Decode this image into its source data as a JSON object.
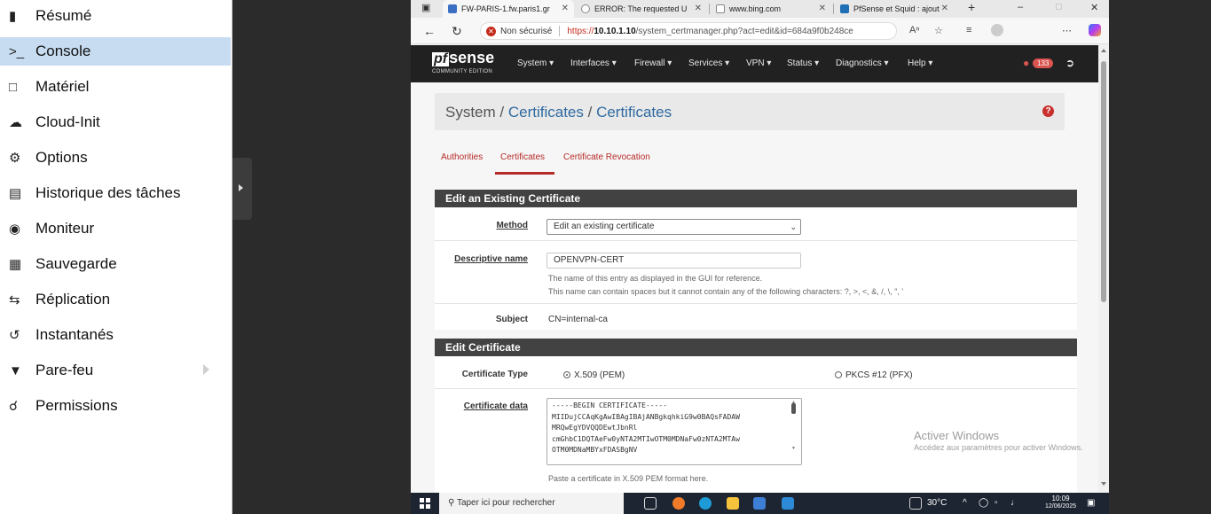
{
  "sidebar": {
    "items": [
      {
        "label": "Résumé",
        "icon": "book-icon"
      },
      {
        "label": "Console",
        "icon": "terminal-icon"
      },
      {
        "label": "Matériel",
        "icon": "monitor-icon"
      },
      {
        "label": "Cloud-Init",
        "icon": "cloud-icon"
      },
      {
        "label": "Options",
        "icon": "gear-icon"
      },
      {
        "label": "Historique des tâches",
        "icon": "list-icon"
      },
      {
        "label": "Moniteur",
        "icon": "eye-icon"
      },
      {
        "label": "Sauvegarde",
        "icon": "floppy-icon"
      },
      {
        "label": "Réplication",
        "icon": "retweet-icon"
      },
      {
        "label": "Instantanés",
        "icon": "history-icon"
      },
      {
        "label": "Pare-feu",
        "icon": "shield-icon"
      },
      {
        "label": "Permissions",
        "icon": "unlock-icon"
      }
    ],
    "active_index": 1
  },
  "browser": {
    "tabs": [
      {
        "title": "FW-PARIS-1.fw.paris1.gr"
      },
      {
        "title": "ERROR: The requested U"
      },
      {
        "title": "www.bing.com"
      },
      {
        "title": "PfSense et Squid : ajout"
      }
    ],
    "new_tab": "+",
    "insecure_label": "Non sécurisé",
    "url_proto": "https://",
    "url_host": "10.10.1.10",
    "url_path": "/system_certmanager.php?act=edit&id=684a9f0b248ce"
  },
  "pfsense": {
    "logo_pf": "pf",
    "logo_sense": "sense",
    "logo_edition": "COMMUNITY EDITION",
    "menu": [
      "System ▾",
      "Interfaces ▾",
      "Firewall ▾",
      "Services ▾",
      "VPN ▾",
      "Status ▾",
      "Diagnostics ▾",
      "Help ▾"
    ],
    "notification_count": "133",
    "breadcrumb": {
      "root": "System",
      "sep": " / ",
      "part1": "Certificates",
      "part2": "Certificates"
    },
    "help_glyph": "?",
    "tabs": [
      "Authorities",
      "Certificates",
      "Certificate Revocation"
    ],
    "panel1": {
      "title": "Edit an Existing Certificate",
      "method_label": "Method",
      "method_value": "Edit an existing certificate",
      "descr_label": "Descriptive name",
      "descr_value": "OPENVPN-CERT",
      "descr_help1": "The name of this entry as displayed in the GUI for reference.",
      "descr_help2": "This name can contain spaces but it cannot contain any of the following characters: ?, >, <, &, /, \\, \", '",
      "subject_label": "Subject",
      "subject_value": "CN=internal-ca"
    },
    "panel2": {
      "title": "Edit Certificate",
      "type_label": "Certificate Type",
      "type_options": [
        "X.509 (PEM)",
        "PKCS #12 (PFX)"
      ],
      "data_label": "Certificate data",
      "cert_lines": [
        "-----BEGIN CERTIFICATE-----",
        "MIIDujCCAqKgAwIBAgIBAjANBgkqhkiG9w0BAQsFADAW",
        "MRQwEgYDVQQDEwtJbnRl",
        "cmGhbC1DQTAeFw0yNTA2MTIwOTM0MDNaFw0zNTA2MTAw",
        "OTM0MDNaMBYxFDASBgNV"
      ],
      "data_help": "Paste a certificate in X.509 PEM format here."
    }
  },
  "windows_watermark": {
    "title": "Activer Windows",
    "subtitle": "Accédez aux paramètres pour activer Windows."
  },
  "taskbar": {
    "search_placeholder": "Taper ici pour rechercher",
    "temperature": "30°C",
    "time": "10:09",
    "date": "12/06/2025"
  }
}
